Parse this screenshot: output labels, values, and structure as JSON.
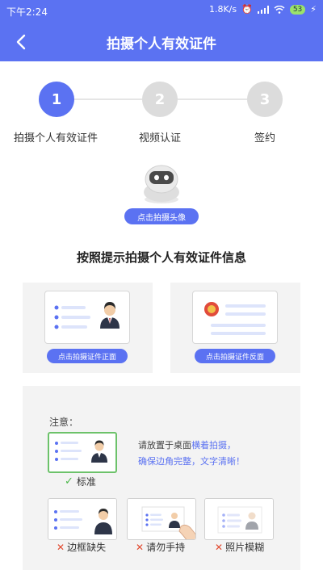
{
  "status_bar": {
    "time": "下午2:24",
    "net_speed": "1.8K/s",
    "battery": "53"
  },
  "header": {
    "title": "拍摄个人有效证件",
    "back_icon": "chevron-left-icon"
  },
  "steps": [
    {
      "number": "1",
      "label": "拍摄个人有效证件",
      "state": "active"
    },
    {
      "number": "2",
      "label": "视频认证",
      "state": "inactive"
    },
    {
      "number": "3",
      "label": "签约",
      "state": "inactive"
    }
  ],
  "avatar": {
    "icon": "robot-avatar-icon",
    "button_label": "点击拍摄头像"
  },
  "section_title": "按照提示拍摄个人有效证件信息",
  "id_capture": {
    "front_label": "点击拍摄证件正面",
    "back_label": "点击拍摄证件反面"
  },
  "notes": {
    "title": "注意：",
    "tip_line1_pre": "请放置于桌面",
    "tip_line1_hl": "横着拍摄，",
    "tip_line2_hl": "确保边角完整，文字清晰！",
    "good_label": "标准",
    "bad_examples": [
      {
        "label": "边框缺失"
      },
      {
        "label": "请勿手持"
      },
      {
        "label": "照片模糊"
      }
    ]
  },
  "colors": {
    "primary": "#5b72f2",
    "inactive": "#dcdcdc",
    "good": "#6cc26a",
    "bad": "#e2492f"
  }
}
